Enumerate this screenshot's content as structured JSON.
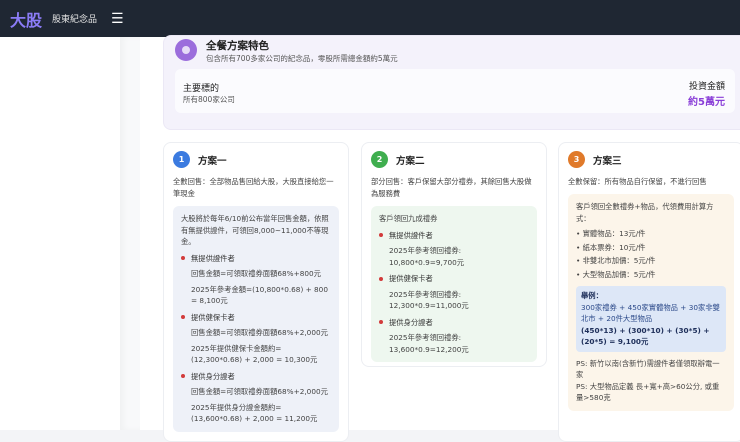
{
  "header": {
    "logo": "大股",
    "subtitle": "股東紀念品",
    "menu_icon": "☰"
  },
  "feature": {
    "title": "全餐方案特色",
    "desc": "包含所有700多家公司的紀念品，零股所需總金額約5萬元",
    "target_label": "主要標的",
    "target_value": "所有800家公司",
    "invest_label": "投資金額",
    "invest_value": "約5萬元"
  },
  "plans": [
    {
      "num": "1",
      "title": "方案一",
      "desc": "全數回售：全部物品售回給大股，大股直接給您一筆現金",
      "intro": "大股將於每年6/10前公布當年回售金額，依照有無提供證件，可領回8,000~11,000不等現金。",
      "items": [
        {
          "label": "無提供證件者",
          "lines": [
            "回售金額=可領取禮券面額68%+800元",
            "2025年參考金額=(10,800*0.68) + 800 = 8,100元"
          ]
        },
        {
          "label": "提供健保卡者",
          "lines": [
            "回售金額=可領取禮券面額68%+2,000元",
            "2025年提供健保卡金額約= (12,300*0.68) + 2,000 = 10,300元"
          ]
        },
        {
          "label": "提供身分證者",
          "lines": [
            "回售金額=可領取禮券面額68%+2,000元",
            "2025年提供身分證金額約= (13,600*0.68) + 2,000 = 11,200元"
          ]
        }
      ]
    },
    {
      "num": "2",
      "title": "方案二",
      "desc": "部分回售：客戶保留大部分禮券，其餘回售大股做為服務費",
      "intro": "客戶領回九成禮券",
      "items": [
        {
          "label": "無提供證件者",
          "lines": [
            "2025年參考領回禮券: 10,800*0.9=9,700元"
          ]
        },
        {
          "label": "提供健保卡者",
          "lines": [
            "2025年參考領回禮券: 12,300*0.9=11,000元"
          ]
        },
        {
          "label": "提供身分證者",
          "lines": [
            "2025年參考領回禮券: 13,600*0.9=12,200元"
          ]
        }
      ]
    },
    {
      "num": "3",
      "title": "方案三",
      "desc": "全數保留：所有物品自行保留，不進行回售",
      "intro": "客戶領回全數禮券+物品，代領費用計算方式：",
      "fees": [
        "• 實體物品：13元/件",
        "• 紙本票券：10元/件",
        "• 非雙北市加價：5元/件",
        "• 大型物品加價：5元/件"
      ],
      "example": {
        "label": "舉例：",
        "text": "300家禮券 + 450家實體物品 + 30家非雙北市 + 20件大型物品",
        "formula": "(450*13) + (300*10) + (30*5) + (20*5) = 9,100元"
      },
      "ps": [
        "PS: 新竹以南(含新竹)需證件者僅領取辦電一家",
        "PS: 大型物品定義 長+寬+高>60公分, 或重量>580克"
      ]
    }
  ],
  "colors": {
    "plan1": "#3b7be0",
    "plan2": "#3fae4f",
    "plan3": "#e07a2a",
    "accent": "#8a3fd8"
  }
}
